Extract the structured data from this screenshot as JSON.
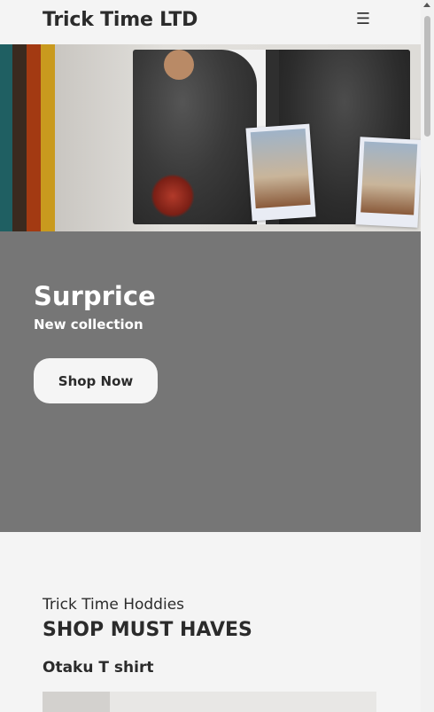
{
  "header": {
    "brand": "Trick Time LTD",
    "menu_icon": "hamburger-icon",
    "menu_glyph": "☰"
  },
  "hero": {
    "title": "Surprice",
    "subtitle": "New collection",
    "cta_label": "Shop Now"
  },
  "section": {
    "eyebrow": "Trick Time Hoddies",
    "title": "SHOP MUST HAVES",
    "product_title": "Otaku T shirt"
  },
  "colors": {
    "hero_panel": "#767676",
    "page_bg": "#f4f4f4",
    "button_bg": "#f5f5f5",
    "stripes": [
      "#1f5f62",
      "#3a2a1f",
      "#a33a12",
      "#c99a1e"
    ]
  }
}
